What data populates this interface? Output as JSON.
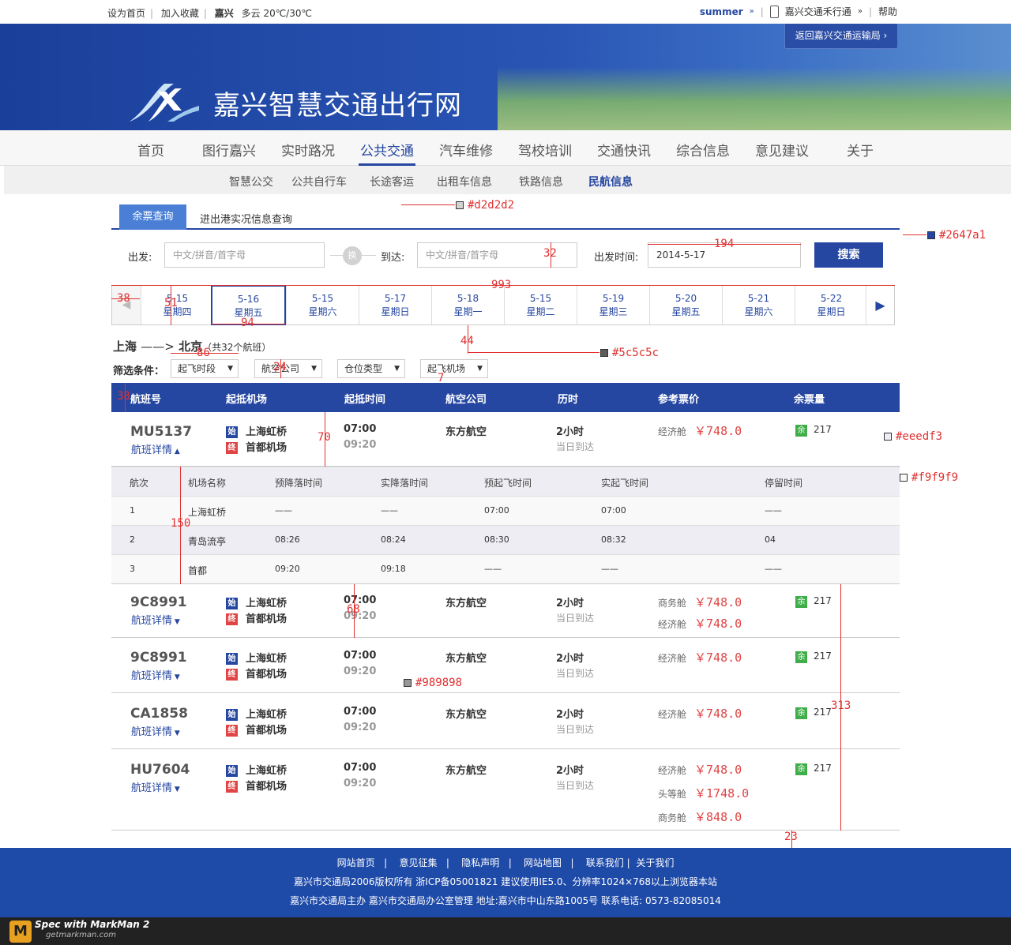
{
  "topbar": {
    "left": [
      "设为首页",
      "加入收藏",
      "嘉兴",
      "多云 20℃/30℃"
    ],
    "user": "summer",
    "app": "嘉兴交通禾行通",
    "help": "帮助"
  },
  "banner": {
    "title": "嘉兴智慧交通出行网",
    "back": "返回嘉兴交通运输局 ›"
  },
  "nav": [
    "首页",
    "图行嘉兴",
    "实时路况",
    "公共交通",
    "汽车维修",
    "驾校培训",
    "交通快讯",
    "综合信息",
    "意见建议",
    "关于"
  ],
  "subnav": [
    "智慧公交",
    "公共自行车",
    "长途客运",
    "出租车信息",
    "铁路信息",
    "民航信息"
  ],
  "tabs": [
    "余票查询",
    "进出港实况信息查询"
  ],
  "search": {
    "from_label": "出发:",
    "from_placeholder": "中文/拼音/首字母",
    "swap": "换",
    "to_label": "到达:",
    "to_placeholder": "中文/拼音/首字母",
    "date_label": "出发时间:",
    "date_value": "2014-5-17",
    "button": "搜索"
  },
  "dates": [
    {
      "d": "5-15",
      "w": "星期四"
    },
    {
      "d": "5-16",
      "w": "星期五"
    },
    {
      "d": "5-15",
      "w": "星期六"
    },
    {
      "d": "5-17",
      "w": "星期日"
    },
    {
      "d": "5-18",
      "w": "星期一"
    },
    {
      "d": "5-15",
      "w": "星期二"
    },
    {
      "d": "5-19",
      "w": "星期三"
    },
    {
      "d": "5-20",
      "w": "星期五"
    },
    {
      "d": "5-21",
      "w": "星期六"
    },
    {
      "d": "5-22",
      "w": "星期日"
    }
  ],
  "route": {
    "from": "上海",
    "arrow": "——>",
    "to": "北京",
    "count": "（共32个航班）"
  },
  "filter": {
    "label": "筛选条件：",
    "options": [
      "起飞时段",
      "航空公司",
      "仓位类型",
      "起飞机场"
    ]
  },
  "table_header": [
    "航班号",
    "起抵机场",
    "起抵时间",
    "航空公司",
    "历时",
    "参考票价",
    "余票量"
  ],
  "flights": [
    {
      "no": "MU5137",
      "detail": "航班详情",
      "dep_ap": "上海虹桥",
      "arr_ap": "首都机场",
      "dep": "07:00",
      "arr": "09:20",
      "airline": "东方航空",
      "dur": "2小时",
      "dur_note": "当日到达",
      "prices": [
        {
          "cls": "经济舱",
          "p": "￥748.0"
        }
      ],
      "seats": "217",
      "expanded": true
    },
    {
      "no": "9C8991",
      "detail": "航班详情",
      "dep_ap": "上海虹桥",
      "arr_ap": "首都机场",
      "dep": "07:00",
      "arr": "09:20",
      "airline": "东方航空",
      "dur": "2小时",
      "dur_note": "当日到达",
      "prices": [
        {
          "cls": "商务舱",
          "p": "￥748.0"
        },
        {
          "cls": "经济舱",
          "p": "￥748.0"
        }
      ],
      "seats": "217"
    },
    {
      "no": "9C8991",
      "detail": "航班详情",
      "dep_ap": "上海虹桥",
      "arr_ap": "首都机场",
      "dep": "07:00",
      "arr": "09:20",
      "airline": "东方航空",
      "dur": "2小时",
      "dur_note": "当日到达",
      "prices": [
        {
          "cls": "经济舱",
          "p": "￥748.0"
        }
      ],
      "seats": "217"
    },
    {
      "no": "CA1858",
      "detail": "航班详情",
      "dep_ap": "上海虹桥",
      "arr_ap": "首都机场",
      "dep": "07:00",
      "arr": "09:20",
      "airline": "东方航空",
      "dur": "2小时",
      "dur_note": "当日到达",
      "prices": [
        {
          "cls": "经济舱",
          "p": "￥748.0"
        }
      ],
      "seats": "217"
    },
    {
      "no": "HU7604",
      "detail": "航班详情",
      "dep_ap": "上海虹桥",
      "arr_ap": "首都机场",
      "dep": "07:00",
      "arr": "09:20",
      "airline": "东方航空",
      "dur": "2小时",
      "dur_note": "当日到达",
      "prices": [
        {
          "cls": "经济舱",
          "p": "￥748.0"
        },
        {
          "cls": "头等舱",
          "p": "￥1748.0"
        },
        {
          "cls": "商务舱",
          "p": "￥848.0"
        }
      ],
      "seats": "217"
    }
  ],
  "tag_dep": "始",
  "tag_arr": "终",
  "tag_seat": "余",
  "stopover": {
    "header": [
      "航次",
      "机场名称",
      "预降落时间",
      "实降落时间",
      "预起飞时间",
      "实起飞时间",
      "停留时间"
    ],
    "rows": [
      [
        "1",
        "上海虹桥",
        "——",
        "——",
        "07:00",
        "07:00",
        "——"
      ],
      [
        "2",
        "青岛流亭",
        "08:26",
        "08:24",
        "08:30",
        "08:32",
        "04"
      ],
      [
        "3",
        "首都",
        "09:20",
        "09:18",
        "——",
        "——",
        "——"
      ]
    ]
  },
  "footer": {
    "links": [
      "网站首页",
      "|",
      "意见征集",
      "|",
      "隐私声明",
      "|",
      "网站地图",
      "|",
      "联系我们",
      "|",
      "关于我们"
    ],
    "line2": "嘉兴市交通局2006版权所有  浙ICP备05001821  建议使用IE5.0、分辨率1024×768以上浏览器本站",
    "line3": "嘉兴市交通局主办  嘉兴市交通局办公室管理    地址:嘉兴市中山东路1005号  联系电话: 0573-82085014"
  },
  "markman": {
    "title": "Spec with MarkMan 2",
    "url": "getmarkman.com",
    "logo": "M"
  },
  "annotations": {
    "c1": "#d2d2d2",
    "c2": "#2647a1",
    "c3": "#5c5c5c",
    "c4": "#eeedf3",
    "c5": "#f9f9f9",
    "c6": "#989898",
    "m32": "32",
    "m194": "194",
    "m993": "993",
    "m38a": "38",
    "m51": "51",
    "m94": "94",
    "m44": "44",
    "m86": "86",
    "m24": "24",
    "m7": "7",
    "m38b": "38",
    "m70": "70",
    "m150": "150",
    "m68": "68",
    "m313": "313",
    "m23": "23"
  },
  "colors": {
    "primary": "#2647a1",
    "price": "#e04444",
    "seat_tag": "#3fae49",
    "tag_dep": "#2647a1",
    "tag_arr": "#e04444"
  }
}
